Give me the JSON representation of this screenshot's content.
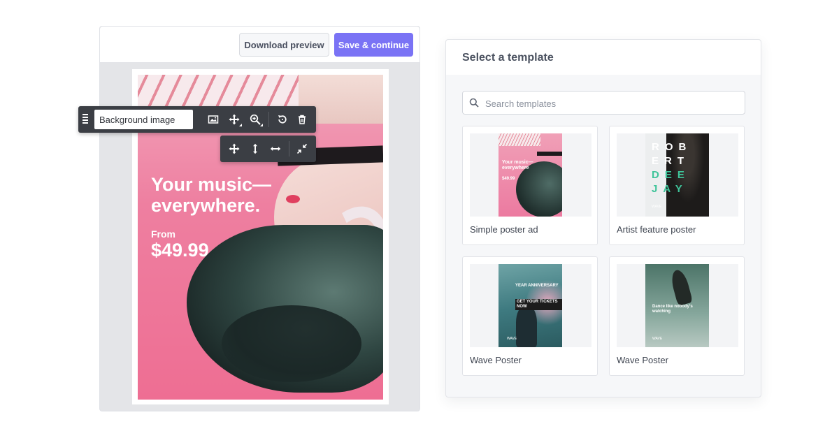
{
  "editor": {
    "download_label": "Download preview",
    "save_label": "Save & continue",
    "poster": {
      "headline": "Your music—everywhere.",
      "from_label": "From",
      "price": "$49.99"
    },
    "layer_toolbar": {
      "layer_name": "Background image",
      "tools": [
        "image-icon",
        "move-icon",
        "zoom-icon",
        "rotate-icon",
        "trash-icon"
      ]
    },
    "resize_toolbar": {
      "tools": [
        "move-icon",
        "vertical-resize-icon",
        "horizontal-resize-icon",
        "shrink-icon"
      ]
    }
  },
  "templates": {
    "title": "Select a template",
    "search_placeholder": "Search templates",
    "items": [
      {
        "label": "Simple poster ad",
        "thumb_text": "Your music—everywhere",
        "thumb_price": "$49.99"
      },
      {
        "label": "Artist feature poster",
        "thumb_lines": [
          "ROB",
          "ERT",
          "DEE",
          "JAY"
        ],
        "thumb_logo": "WAVE"
      },
      {
        "label": "Wave Poster",
        "thumb_line1": "YEAR ANNIVERSARY",
        "thumb_line2": "GET YOUR TICKETS NOW",
        "thumb_logo": "WAVE"
      },
      {
        "label": "Wave Poster",
        "thumb_text": "Dance like nobody's watching",
        "thumb_logo": "WAVE"
      }
    ]
  },
  "colors": {
    "primary": "#7a73f5",
    "toolbar": "#3b3e44",
    "poster_pink": "#ee7fa0",
    "accent_green": "#3fc49a"
  }
}
